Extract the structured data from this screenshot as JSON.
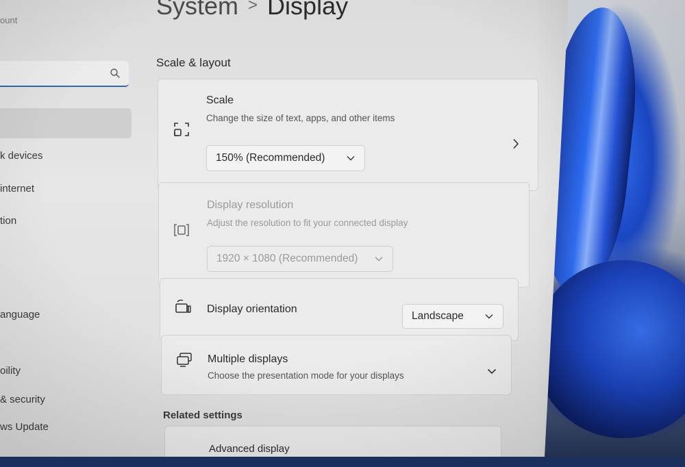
{
  "sidebar": {
    "account_fragment": "ount",
    "search": {
      "value": "",
      "placeholder": ""
    },
    "items": [
      {
        "label": "k devices"
      },
      {
        "label": "internet"
      },
      {
        "label": "tion"
      },
      {
        "label": "anguage"
      },
      {
        "label": "oility"
      },
      {
        "label": "& security"
      },
      {
        "label": "ws Update"
      }
    ]
  },
  "header": {
    "breadcrumb_parent": "System",
    "breadcrumb_separator": ">",
    "page_title": "Display"
  },
  "scale_layout": {
    "title": "Scale & layout",
    "scale": {
      "title": "Scale",
      "description": "Change the size of text, apps, and other items",
      "selected": "150% (Recommended)",
      "icon": "scale-icon"
    },
    "resolution": {
      "title": "Display resolution",
      "description": "Adjust the resolution to fit your connected display",
      "selected": "1920 × 1080 (Recommended)",
      "icon": "resolution-icon"
    },
    "orientation": {
      "title": "Display orientation",
      "selected": "Landscape",
      "icon": "rotate-screen-icon"
    },
    "multiple": {
      "title": "Multiple displays",
      "description": "Choose the presentation mode for your displays",
      "icon": "multiple-displays-icon"
    }
  },
  "related_settings": {
    "title": "Related settings",
    "items": [
      {
        "label": "Advanced display"
      }
    ]
  },
  "colors": {
    "accent": "#3468a8",
    "card_bg": "#ebebeb",
    "window_bg": "#e3e3e3"
  }
}
